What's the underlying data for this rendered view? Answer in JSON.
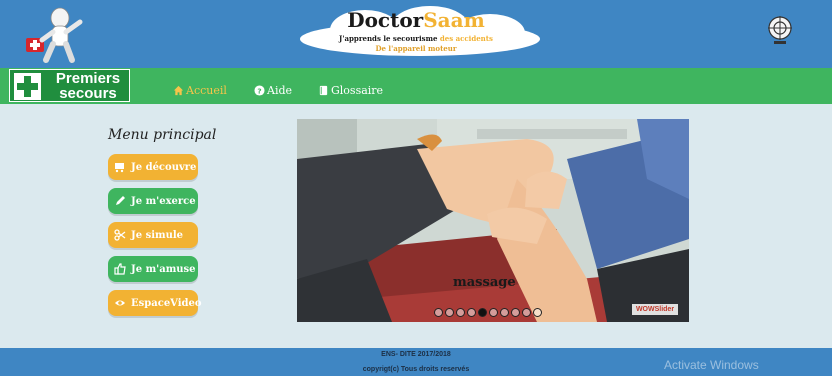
{
  "header": {
    "brand_main": "Doctor",
    "brand_accent": "Saam",
    "tagline_main": "J'apprends le secourisme ",
    "tagline_accent": "des accidents",
    "tagline_line2": "De l'appareil moteur"
  },
  "nav": {
    "brand_line1": "Premiers",
    "brand_line2": "secours",
    "links": [
      {
        "label": "Accueil",
        "icon": "home-icon"
      },
      {
        "label": "Aide",
        "icon": "question-icon"
      },
      {
        "label": "Glossaire",
        "icon": "book-icon"
      }
    ]
  },
  "menu": {
    "title": "Menu principal",
    "items": [
      {
        "label": "Je découvre",
        "icon": "cart-icon",
        "color": "#f2b233"
      },
      {
        "label": "Je m'exerce",
        "icon": "pencil-icon",
        "color": "#3fb55f"
      },
      {
        "label": "Je simule",
        "icon": "scissors-icon",
        "color": "#f2b233"
      },
      {
        "label": "Je m'amuse",
        "icon": "thumbs-up-icon",
        "color": "#3fb55f"
      },
      {
        "label": "EspaceVideo",
        "icon": "eye-icon",
        "color": "#f2b233"
      }
    ]
  },
  "slider": {
    "caption": "massage",
    "slide_count": 10,
    "active_index": 4,
    "watermark": "WOWSlider"
  },
  "footer": {
    "line1": "ENS- DITE 2017/2018",
    "line2": "copyrigt(c) Tous droits reservés"
  },
  "overlay": {
    "activate": "Activate Windows"
  },
  "colors": {
    "header_blue": "#3f86c3",
    "nav_green": "#3fb55f",
    "accent_yellow": "#f2b233",
    "page_bg": "#dbe9ee"
  }
}
